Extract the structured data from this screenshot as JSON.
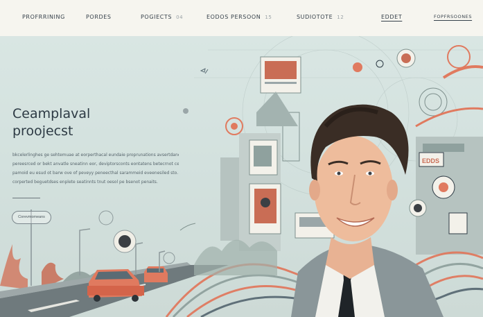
{
  "nav": {
    "items": [
      {
        "label": "PROFRRINING",
        "num": ""
      },
      {
        "label": "PORDES",
        "num": ""
      },
      {
        "label": "POGIECTS",
        "num": "04"
      },
      {
        "label": "EODOS PERSOON",
        "num": "15"
      },
      {
        "label": "SUDIOTOTE",
        "num": "12"
      },
      {
        "label": "EDDET",
        "num": ""
      },
      {
        "label": "FOPFRSOONES",
        "num": ""
      }
    ]
  },
  "hero": {
    "title_line1": "Ceamplaval",
    "title_line2": "proojecst",
    "body_lines": [
      "bkcelerlinghes ge sehtemuae at eorperthacal eundaie proprunations avsertdanetin.",
      "pereesrced or bekt anvatle sneatinn eor, deviptorsconts eontatens betecrnot ceoemco e.",
      "pamoid eu esud ot barw ove of peveyy peneecthal sarammeid eveenesiled sto.",
      "corperted beguetdses enplete seatinnts tnut oesol pe bsenot penaits."
    ],
    "cta_label": "Corevmomeans",
    "sign_text": "EDDS"
  },
  "colors": {
    "accent": "#e07a5f",
    "dark": "#2d3a44",
    "teal_bg": "#d3e1de"
  }
}
